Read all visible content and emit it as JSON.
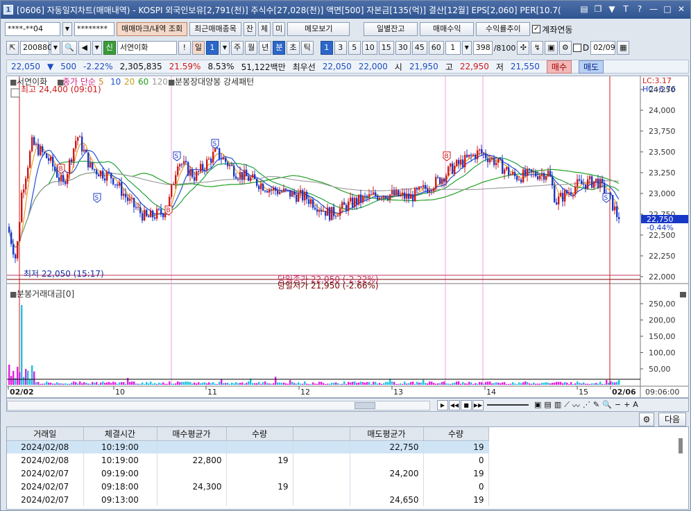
{
  "window": {
    "title": "[0606] 자동일지차트(매매내역) - KOSPI 외국인보유[2,791(천)] 주식수[27,028(천)] 액면[500] 자본금[135(억)] 결산[12월] EPS[2,060] PER[10.7("
  },
  "toolbar1": {
    "account_value": "****-**04",
    "password_value": "********",
    "buttons": [
      "매매마크/내역 조회",
      "최근매매종목",
      "잔",
      "체",
      "미",
      "메모보기",
      "일별잔고",
      "매매수익",
      "수익률추이"
    ],
    "link_checkbox_label": "계좌연동"
  },
  "toolbar2": {
    "code_value": "200880",
    "credit_badge": "신",
    "stock_name": "서연이화",
    "warn": "!",
    "period_day": "일",
    "period_count": "1",
    "periods": [
      "주",
      "월",
      "년",
      "분",
      "초",
      "틱"
    ],
    "intervals": [
      "1",
      "3",
      "5",
      "10",
      "15",
      "30",
      "45",
      "60"
    ],
    "interval_sel": "1",
    "count_value": "398",
    "count_total": "/8100",
    "d_label": "D",
    "date_value": "02/09"
  },
  "quote": {
    "price": "22,050",
    "change": "500",
    "change_pct": "-2.22%",
    "volume": "2,305,835",
    "ratio1": "21.59%",
    "ratio2": "8.53%",
    "amount": "51,122백만",
    "best_label": "최우선",
    "best_ask": "22,050",
    "best_bid": "22,000",
    "open_label": "시",
    "open": "21,950",
    "high_label": "고",
    "high": "22,950",
    "low_label": "저",
    "low": "21,550",
    "buy_label": "매수",
    "sell_label": "매도"
  },
  "chart": {
    "stock_tag": "서연이화",
    "ma_label": "종가 단순",
    "ma_periods": [
      "5",
      "10",
      "20",
      "60",
      "120"
    ],
    "pattern_label": "분봉장대양봉 강세패턴",
    "lc_label": "LC:3.17",
    "hc_label": "HC:-6.76",
    "max_label": "최고 24,400 (09:01)",
    "min_label": "최저 22,050 (15:17)",
    "close_label": "당일종가 22,050 (-2.22%)",
    "low_label": "당일저가 21,950 (-2.66%)",
    "current_price": "22,750",
    "current_pct": "-0.44%",
    "volume_title": "분봉거래대금[0]",
    "time_label": "09:06:00",
    "price_axis": [
      "24,250",
      "24,000",
      "23,750",
      "23,500",
      "23,250",
      "23,000",
      "22,750",
      "22,500",
      "22,250",
      "22,000"
    ],
    "volume_axis": [
      "250,00",
      "200,00",
      "150,00",
      "100,00",
      "50,00"
    ],
    "x_labels": [
      "02/02",
      "10",
      "11",
      "12",
      "13",
      "14",
      "15",
      "02/06"
    ],
    "colors": {
      "up": "#d01818",
      "down": "#1838c8",
      "ma5": "#e8a020",
      "ma10": "#2050d0",
      "ma20": "#20a040",
      "ma60": "#20a020",
      "ma120": "#a0a0a0",
      "vol": "#e020e0",
      "vol2": "#20c0e0"
    }
  },
  "bottom": {
    "next_label": "다음"
  },
  "trades": {
    "headers": [
      "거래일",
      "체결시간",
      "매수평균가",
      "수량",
      "",
      "매도평균가",
      "수량"
    ],
    "rows": [
      [
        "2024/02/08",
        "10:19:00",
        "",
        "",
        "",
        "22,750",
        "19"
      ],
      [
        "2024/02/08",
        "10:19:00",
        "22,800",
        "19",
        "",
        "",
        "0"
      ],
      [
        "2024/02/07",
        "09:19:00",
        "",
        "",
        "",
        "24,200",
        "19"
      ],
      [
        "2024/02/07",
        "09:18:00",
        "24,300",
        "19",
        "",
        "",
        "0"
      ],
      [
        "2024/02/07",
        "09:13:00",
        "",
        "",
        "",
        "24,650",
        "19"
      ]
    ]
  }
}
